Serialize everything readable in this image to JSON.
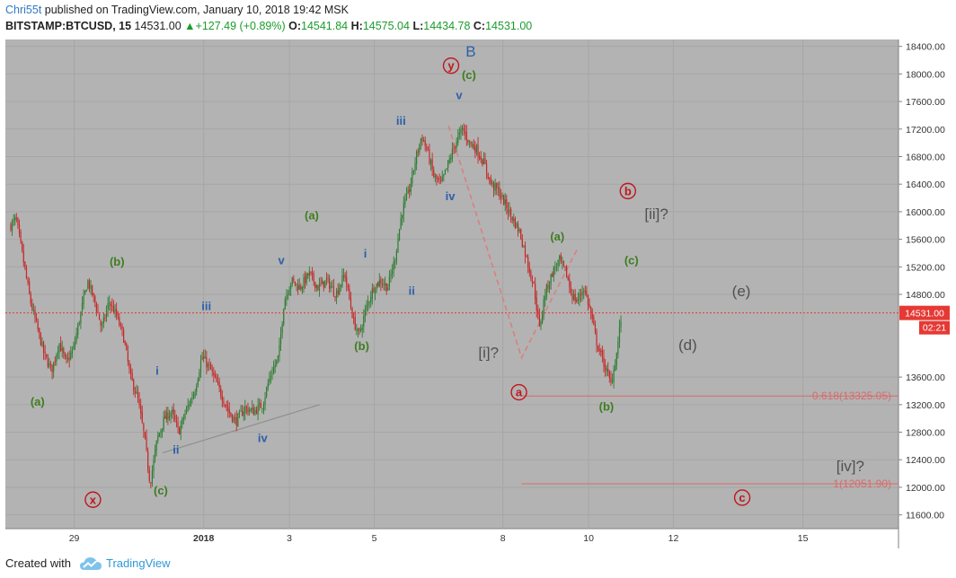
{
  "header": {
    "author": "Chri55t",
    "published": "published on TradingView.com, January 10, 2018 19:42 MSK",
    "symbol": "BITSTAMP:BTCUSD, 15",
    "last": "14531.00",
    "change": "+127.49 (+0.89%)",
    "open_label": "O:",
    "open": "14541.84",
    "high_label": "H:",
    "high": "14575.04",
    "low_label": "L:",
    "low": "14434.78",
    "close_label": "C:",
    "close": "14531.00",
    "change_color": "#1a9c2c"
  },
  "footer": {
    "created_with": "Created with",
    "brand": "TradingView"
  },
  "colors": {
    "plot_bg": "#b3b3b3",
    "bull": "#2e7d32",
    "bear": "#c62828",
    "wave_green": "#3f7d20",
    "wave_blue": "#2c5fa8",
    "wave_red": "#c0161c",
    "wave_gray": "#505050"
  },
  "chart_data": {
    "type": "candlestick",
    "title": "",
    "xlabel": "",
    "ylabel": "",
    "ylim": [
      11400,
      18500
    ],
    "xlim": [
      0,
      1000
    ],
    "x_ticks": [
      {
        "x": 77,
        "label": "29",
        "bold": false
      },
      {
        "x": 222,
        "label": "2018",
        "bold": true
      },
      {
        "x": 318,
        "label": "3",
        "bold": false
      },
      {
        "x": 413,
        "label": "5",
        "bold": false
      },
      {
        "x": 557,
        "label": "8",
        "bold": false
      },
      {
        "x": 653,
        "label": "10",
        "bold": false
      },
      {
        "x": 748,
        "label": "12",
        "bold": false
      },
      {
        "x": 893,
        "label": "15",
        "bold": false
      }
    ],
    "y_ticks": [
      "18400.00",
      "18000.00",
      "17600.00",
      "17200.00",
      "16800.00",
      "16400.00",
      "16000.00",
      "15600.00",
      "15200.00",
      "14800.00",
      "13600.00",
      "13200.00",
      "12800.00",
      "12400.00",
      "12000.00",
      "11600.00"
    ],
    "y_tick_values": [
      18400,
      18000,
      17600,
      17200,
      16800,
      16400,
      16000,
      15600,
      15200,
      14800,
      13600,
      13200,
      12800,
      12400,
      12000,
      11600
    ],
    "current_price": 14531.0,
    "current_price_label": "14531.00",
    "countdown_label": "02:21",
    "price_path": [
      [
        6,
        15800
      ],
      [
        12,
        15900
      ],
      [
        20,
        15300
      ],
      [
        28,
        14700
      ],
      [
        36,
        14300
      ],
      [
        44,
        13900
      ],
      [
        52,
        13700
      ],
      [
        60,
        14100
      ],
      [
        68,
        13800
      ],
      [
        76,
        14000
      ],
      [
        84,
        14500
      ],
      [
        92,
        15000
      ],
      [
        100,
        14700
      ],
      [
        108,
        14300
      ],
      [
        116,
        14700
      ],
      [
        124,
        14500
      ],
      [
        132,
        14200
      ],
      [
        140,
        13600
      ],
      [
        148,
        13300
      ],
      [
        156,
        12700
      ],
      [
        162,
        12050
      ],
      [
        170,
        12700
      ],
      [
        178,
        13000
      ],
      [
        186,
        13100
      ],
      [
        194,
        12800
      ],
      [
        202,
        13100
      ],
      [
        212,
        13400
      ],
      [
        220,
        13900
      ],
      [
        230,
        13700
      ],
      [
        240,
        13400
      ],
      [
        250,
        13100
      ],
      [
        258,
        12950
      ],
      [
        268,
        13150
      ],
      [
        278,
        13100
      ],
      [
        288,
        13200
      ],
      [
        296,
        13600
      ],
      [
        306,
        13900
      ],
      [
        312,
        14700
      ],
      [
        320,
        15000
      ],
      [
        330,
        14900
      ],
      [
        340,
        15100
      ],
      [
        350,
        14900
      ],
      [
        360,
        15000
      ],
      [
        370,
        14800
      ],
      [
        380,
        15100
      ],
      [
        390,
        14400
      ],
      [
        396,
        14200
      ],
      [
        404,
        14600
      ],
      [
        412,
        14900
      ],
      [
        420,
        15000
      ],
      [
        428,
        14900
      ],
      [
        436,
        15300
      ],
      [
        444,
        16000
      ],
      [
        452,
        16300
      ],
      [
        460,
        16800
      ],
      [
        466,
        17100
      ],
      [
        472,
        16900
      ],
      [
        480,
        16500
      ],
      [
        488,
        16400
      ],
      [
        496,
        16700
      ],
      [
        504,
        17000
      ],
      [
        512,
        17200
      ],
      [
        520,
        17000
      ],
      [
        528,
        16900
      ],
      [
        536,
        16700
      ],
      [
        544,
        16400
      ],
      [
        552,
        16300
      ],
      [
        560,
        16100
      ],
      [
        568,
        15900
      ],
      [
        576,
        15700
      ],
      [
        584,
        15300
      ],
      [
        592,
        14900
      ],
      [
        598,
        14300
      ],
      [
        604,
        14800
      ],
      [
        612,
        15100
      ],
      [
        620,
        15300
      ],
      [
        628,
        15100
      ],
      [
        634,
        14800
      ],
      [
        640,
        14700
      ],
      [
        648,
        14900
      ],
      [
        656,
        14500
      ],
      [
        662,
        14100
      ],
      [
        670,
        13800
      ],
      [
        678,
        13500
      ],
      [
        684,
        13900
      ],
      [
        690,
        14531
      ]
    ],
    "wave_labels": [
      {
        "text": "(a)",
        "x": 36,
        "y": 13250,
        "color": "green"
      },
      {
        "text": "(b)",
        "x": 125,
        "y": 15280,
        "color": "green"
      },
      {
        "text": "(c)",
        "x": 174,
        "y": 11960,
        "color": "green"
      },
      {
        "text": "x",
        "x": 98,
        "y": 11820,
        "color": "red",
        "circle": true
      },
      {
        "text": "i",
        "x": 170,
        "y": 13700,
        "color": "blue"
      },
      {
        "text": "ii",
        "x": 191,
        "y": 12550,
        "color": "blue"
      },
      {
        "text": "iii",
        "x": 225,
        "y": 14640,
        "color": "blue"
      },
      {
        "text": "iv",
        "x": 288,
        "y": 12720,
        "color": "blue"
      },
      {
        "text": "v",
        "x": 309,
        "y": 15300,
        "color": "blue"
      },
      {
        "text": "(a)",
        "x": 343,
        "y": 15950,
        "color": "green"
      },
      {
        "text": "i",
        "x": 403,
        "y": 15400,
        "color": "blue"
      },
      {
        "text": "ii",
        "x": 455,
        "y": 14860,
        "color": "blue"
      },
      {
        "text": "(b)",
        "x": 399,
        "y": 14060,
        "color": "green"
      },
      {
        "text": "iii",
        "x": 443,
        "y": 17330,
        "color": "blue"
      },
      {
        "text": "iv",
        "x": 498,
        "y": 16230,
        "color": "blue"
      },
      {
        "text": "v",
        "x": 508,
        "y": 17700,
        "color": "blue"
      },
      {
        "text": "y",
        "x": 499,
        "y": 18120,
        "color": "red",
        "circle": true
      },
      {
        "text": "(c)",
        "x": 519,
        "y": 17990,
        "color": "green"
      },
      {
        "text": "B",
        "x": 521,
        "y": 18320,
        "color": "blue",
        "large": true
      },
      {
        "text": "[i]?",
        "x": 541,
        "y": 13950,
        "color": "gray",
        "large": true
      },
      {
        "text": "a",
        "x": 575,
        "y": 13380,
        "color": "red",
        "circle": true
      },
      {
        "text": "(a)",
        "x": 618,
        "y": 15650,
        "color": "green"
      },
      {
        "text": "b",
        "x": 697,
        "y": 16300,
        "color": "red",
        "circle": true
      },
      {
        "text": "[ii]?",
        "x": 729,
        "y": 15960,
        "color": "gray",
        "large": true
      },
      {
        "text": "(c)",
        "x": 701,
        "y": 15300,
        "color": "green"
      },
      {
        "text": "(b)",
        "x": 673,
        "y": 13180,
        "color": "green"
      },
      {
        "text": "(e)",
        "x": 824,
        "y": 14840,
        "color": "gray",
        "large": true
      },
      {
        "text": "(d)",
        "x": 764,
        "y": 14060,
        "color": "gray",
        "large": true
      },
      {
        "text": "[iv]?",
        "x": 946,
        "y": 12300,
        "color": "gray",
        "large": true
      },
      {
        "text": "c",
        "x": 825,
        "y": 11850,
        "color": "red",
        "circle": true
      }
    ],
    "fib_levels": [
      {
        "value": 13325.05,
        "label": "0.618(13325.05)",
        "x_start": 578
      },
      {
        "value": 12051.9,
        "label": "1(12051.90)",
        "x_start": 578
      }
    ],
    "annotations": [
      {
        "type": "trendline",
        "points": [
          [
            176,
            12500
          ],
          [
            352,
            13200
          ]
        ],
        "color": "#8f8f8f"
      },
      {
        "type": "dashed",
        "points": [
          [
            496,
            17250
          ],
          [
            578,
            13880
          ],
          [
            640,
            15450
          ]
        ],
        "color": "#d88080"
      }
    ]
  }
}
